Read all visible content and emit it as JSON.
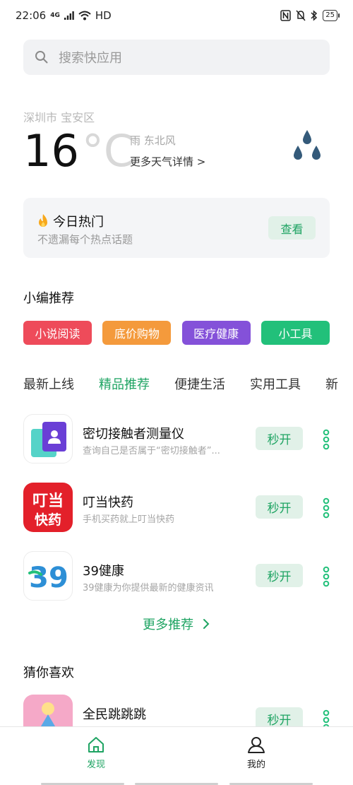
{
  "status_bar": {
    "time": "22:06",
    "network": "4G",
    "hd": "HD",
    "battery": "25"
  },
  "search": {
    "placeholder": "搜索快应用"
  },
  "weather": {
    "location": "深圳市 宝安区",
    "temperature": "16",
    "unit": "°C",
    "condition": "雨 东北风",
    "more": "更多天气详情 >",
    "icon": "rain-drops-icon"
  },
  "hot_today": {
    "title": "今日热门",
    "subtitle": "不遗漏每个热点话题",
    "button": "查看"
  },
  "editor_picks": {
    "title": "小编推荐",
    "chips": [
      {
        "label": "小说阅读",
        "color": "#ee4b5a"
      },
      {
        "label": "底价购物",
        "color": "#f49a3c"
      },
      {
        "label": "医疗健康",
        "color": "#8451d9"
      },
      {
        "label": "小工具",
        "color": "#22c07a"
      }
    ]
  },
  "tabs": [
    "最新上线",
    "精品推荐",
    "便捷生活",
    "实用工具",
    "新"
  ],
  "active_tab": "精品推荐",
  "apps": [
    {
      "name": "密切接触者测量仪",
      "desc": "查询自己是否属于“密切接触者”...",
      "button": "秒开"
    },
    {
      "name": "叮当快药",
      "desc": "手机买药就上叮当快药",
      "button": "秒开",
      "icon_text_top": "叮当",
      "icon_text_bottom": "快药"
    },
    {
      "name": "39健康",
      "desc": "39健康为你提供最新的健康资讯",
      "button": "秒开",
      "icon_text": "39"
    }
  ],
  "more_recommend": "更多推荐",
  "guess": {
    "title": "猜你喜欢",
    "apps": [
      {
        "name": "全民跳跳跳",
        "button": "秒开"
      }
    ]
  },
  "bottom_nav": [
    {
      "label": "发现",
      "icon": "home-icon",
      "active": true
    },
    {
      "label": "我的",
      "icon": "person-icon",
      "active": false
    }
  ],
  "colors": {
    "accent": "#1fa463",
    "accent_bg": "#e1f1e8",
    "weather_icon": "#345a7a"
  }
}
